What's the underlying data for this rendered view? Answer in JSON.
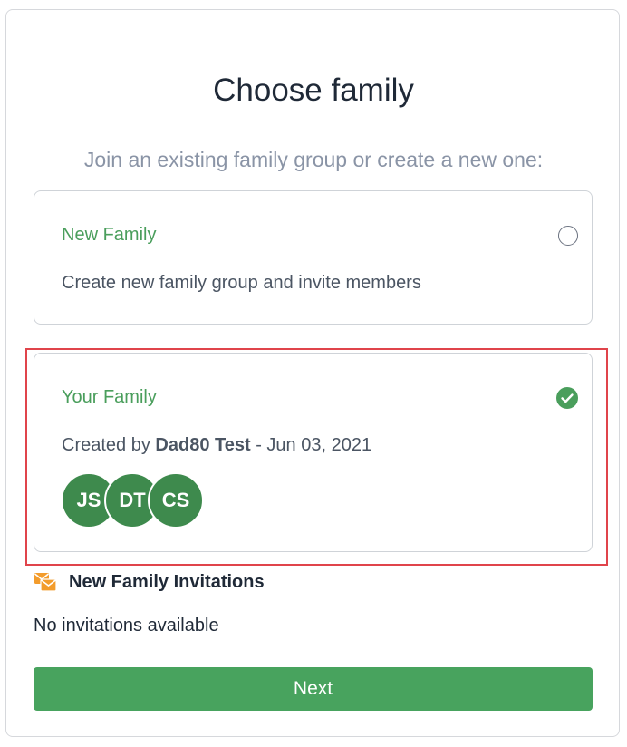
{
  "header": {
    "title": "Choose family",
    "subtitle": "Join an existing family group or create a new one:"
  },
  "options": [
    {
      "title": "New Family",
      "description": "Create new family group and invite members",
      "selected": false
    },
    {
      "title": "Your Family",
      "created_prefix": "Created by",
      "creator": "Dad80 Test",
      "separator": " - ",
      "created_date": "Jun 03, 2021",
      "selected": true,
      "members": [
        "JS",
        "DT",
        "CS"
      ]
    }
  ],
  "invitations": {
    "icon": "envelopes-icon",
    "title": "New Family Invitations",
    "empty_text": "No invitations available"
  },
  "actions": {
    "next_label": "Next"
  },
  "colors": {
    "accent_green": "#4a9e5c",
    "button_green": "#48a35e",
    "avatar_green": "#3e8a4d",
    "highlight_red": "#e0444b",
    "icon_orange": "#f39c2c"
  }
}
